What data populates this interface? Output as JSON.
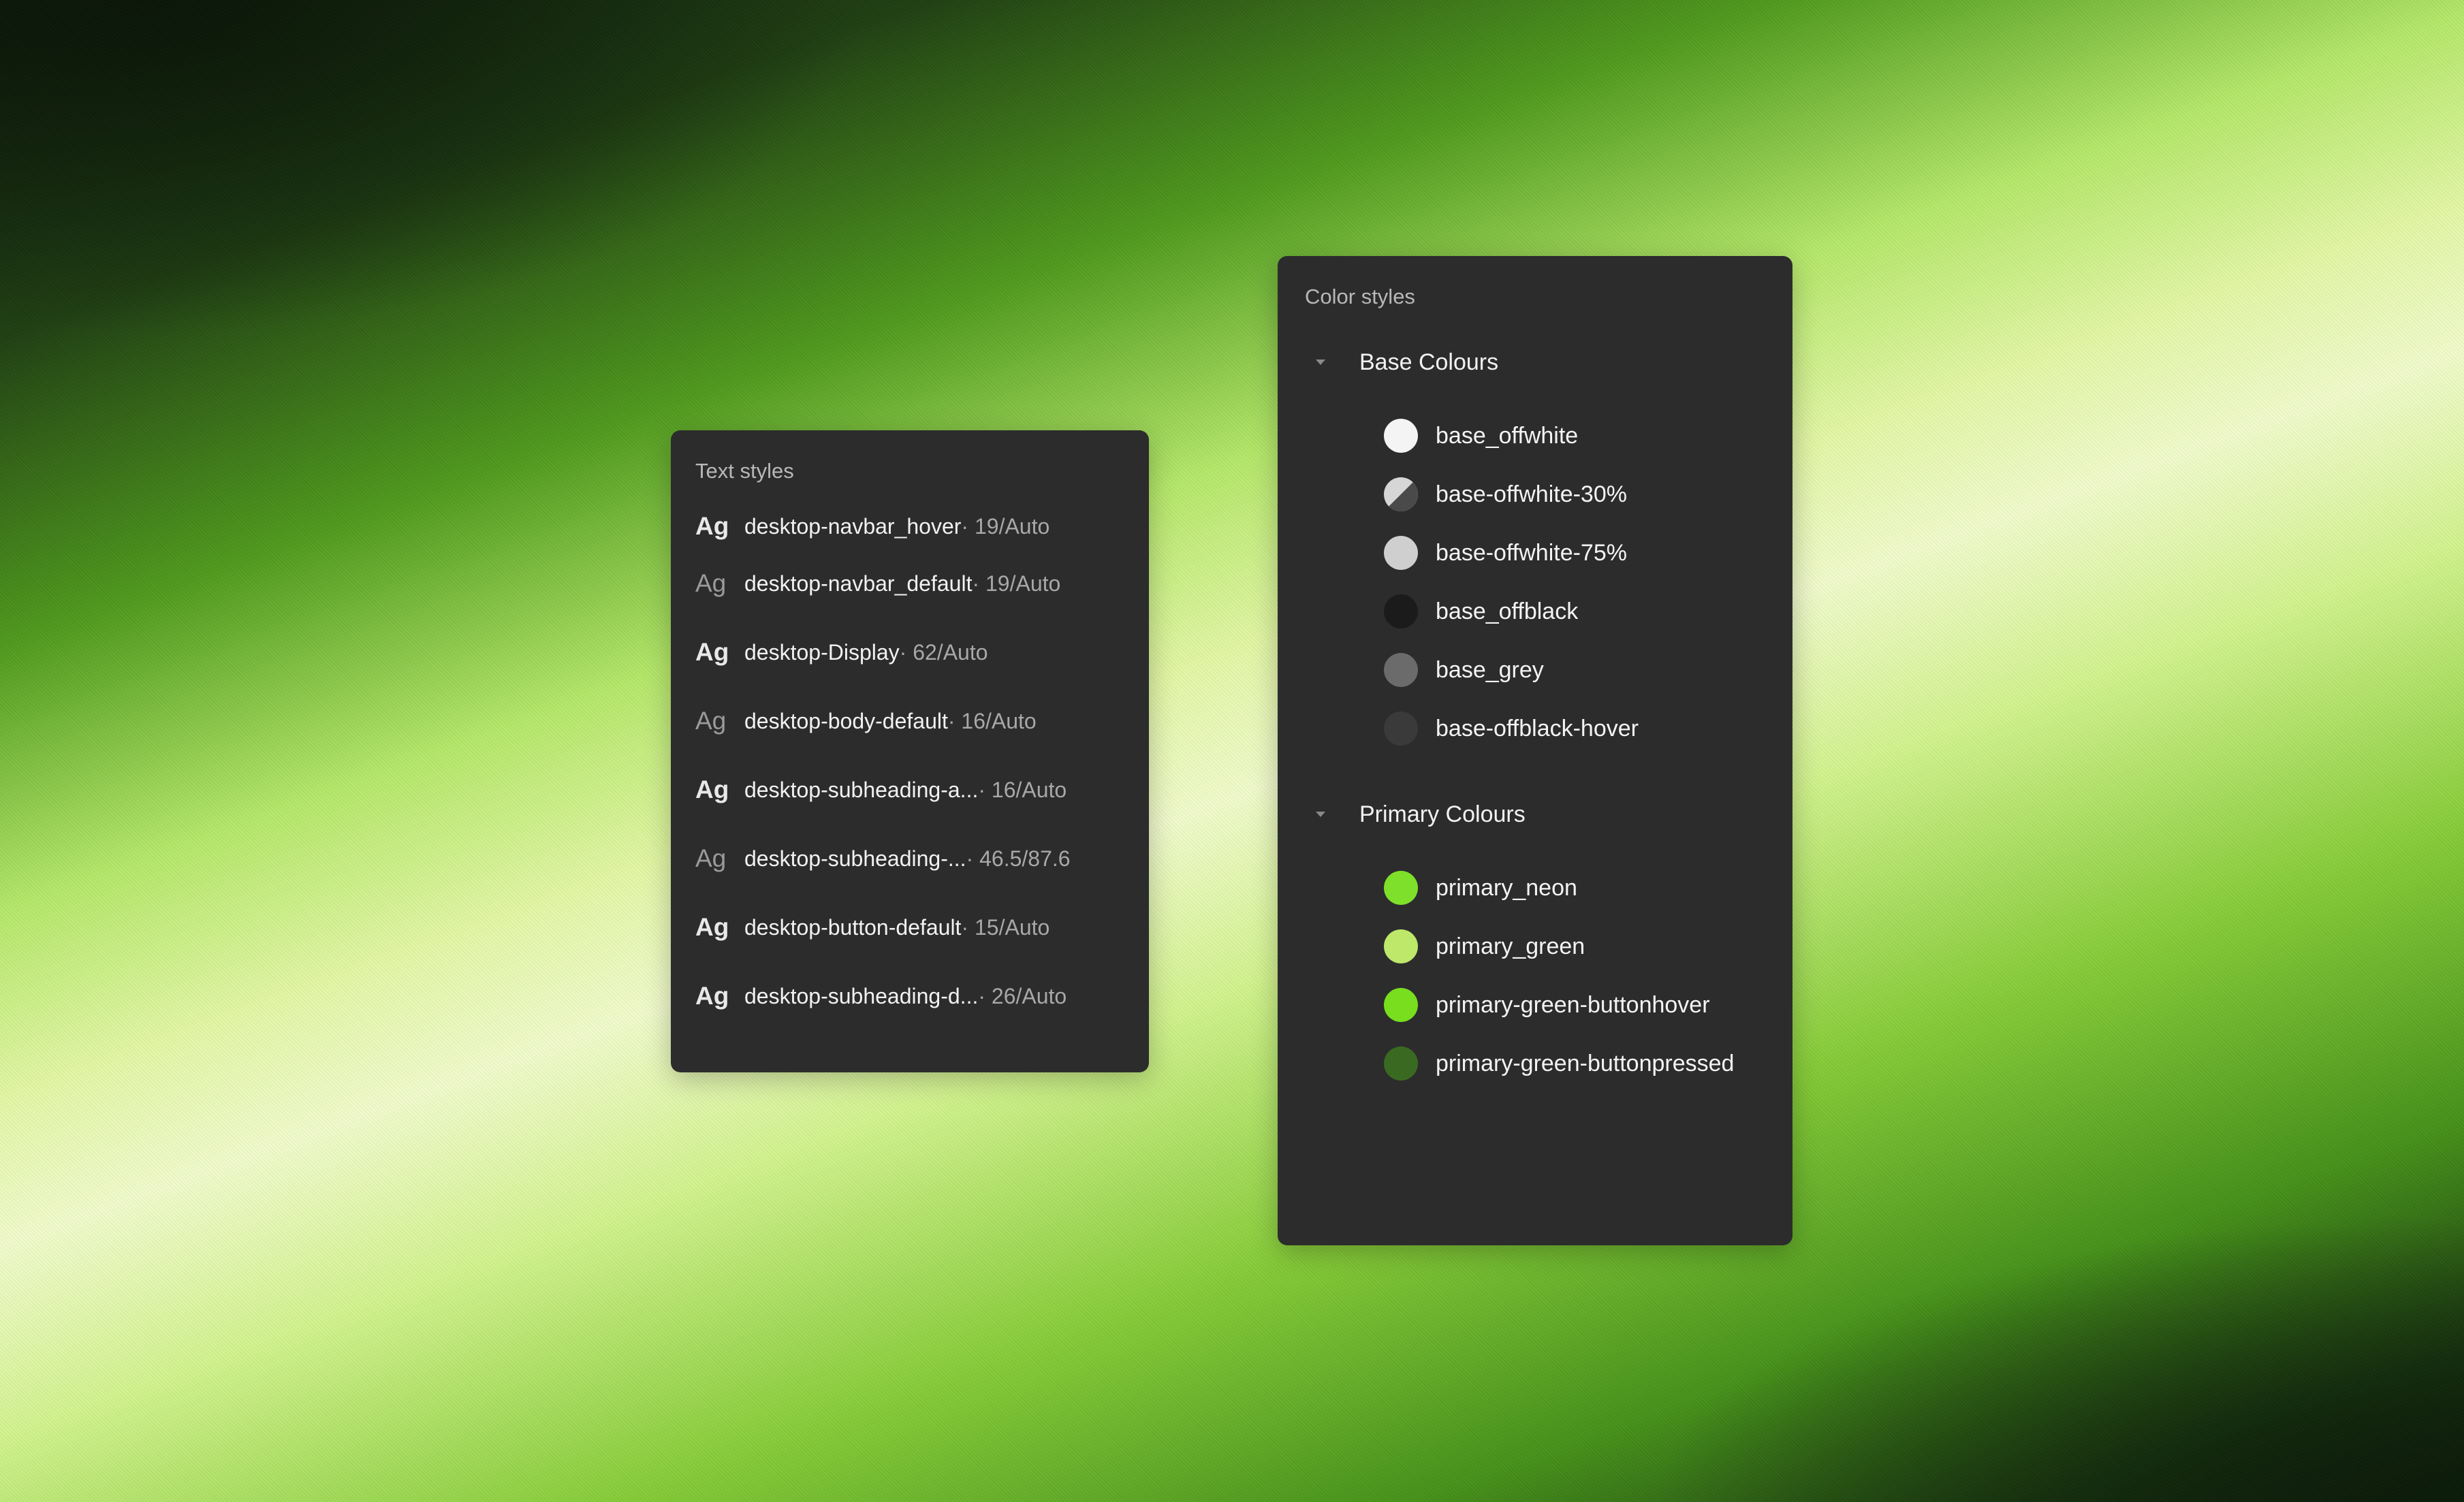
{
  "text_styles": {
    "title": "Text styles",
    "items": [
      {
        "ag": "Ag",
        "weight": "bold",
        "name": "desktop-navbar_hover",
        "meta": " · 19/Auto"
      },
      {
        "ag": "Ag",
        "weight": "light",
        "name": "desktop-navbar_default",
        "meta": " · 19/Auto"
      },
      {
        "ag": "Ag",
        "weight": "bold",
        "name": "desktop-Display",
        "meta": " · 62/Auto"
      },
      {
        "ag": "Ag",
        "weight": "light",
        "name": "desktop-body-default",
        "meta": " · 16/Auto"
      },
      {
        "ag": "Ag",
        "weight": "bold",
        "name": "desktop-subheading-a...",
        "meta": " · 16/Auto"
      },
      {
        "ag": "Ag",
        "weight": "light",
        "name": "desktop-subheading-...",
        "meta": " · 46.5/87.6"
      },
      {
        "ag": "Ag",
        "weight": "bold",
        "name": "desktop-button-default",
        "meta": " · 15/Auto"
      },
      {
        "ag": "Ag",
        "weight": "bold",
        "name": "desktop-subheading-d...",
        "meta": " · 26/Auto"
      }
    ]
  },
  "color_styles": {
    "title": "Color styles",
    "groups": [
      {
        "label": "Base Colours",
        "items": [
          {
            "name": "base_offwhite",
            "color": "#f4f4f4",
            "style": "solid"
          },
          {
            "name": "base-offwhite-30%",
            "color": "#9a9a9a",
            "style": "half"
          },
          {
            "name": "base-offwhite-75%",
            "color": "#cfcfcf",
            "style": "solid"
          },
          {
            "name": "base_offblack",
            "color": "#1b1b1b",
            "style": "solid"
          },
          {
            "name": "base_grey",
            "color": "#6b6b6b",
            "style": "solid"
          },
          {
            "name": "base-offblack-hover",
            "color": "#3a3a3a",
            "style": "solid"
          }
        ]
      },
      {
        "label": "Primary Colours",
        "items": [
          {
            "name": "primary_neon",
            "color": "#7ee02a",
            "style": "solid"
          },
          {
            "name": "primary_green",
            "color": "#bde86a",
            "style": "solid"
          },
          {
            "name": "primary-green-buttonhover",
            "color": "#78de1e",
            "style": "solid"
          },
          {
            "name": "primary-green-buttonpressed",
            "color": "#3a6a22",
            "style": "solid"
          }
        ]
      }
    ]
  }
}
